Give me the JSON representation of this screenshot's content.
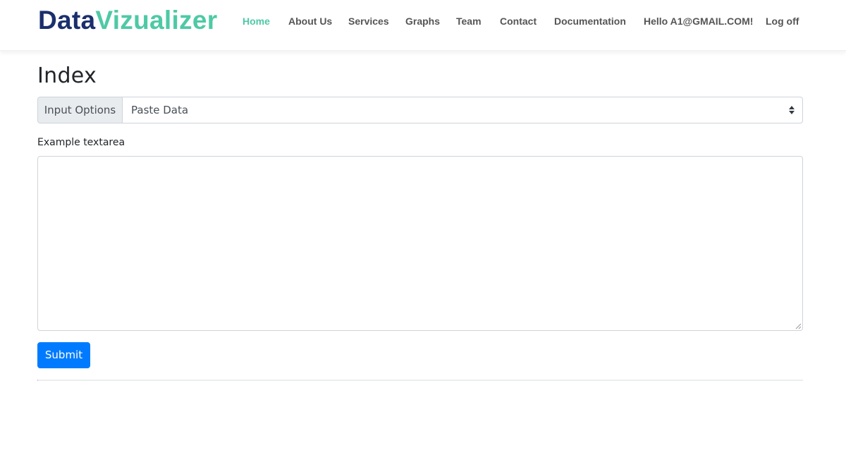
{
  "brand": {
    "part1": "Data",
    "part2": "Vizualizer",
    "color_part1": "#1b2f6e",
    "color_part2": "#4ec9a5"
  },
  "nav": {
    "items": [
      {
        "label": "Home",
        "active": true
      },
      {
        "label": "About Us",
        "active": false
      },
      {
        "label": "Services",
        "active": false
      },
      {
        "label": "Graphs",
        "active": false
      },
      {
        "label": "Team",
        "active": false
      },
      {
        "label": "Contact",
        "active": false
      },
      {
        "label": "Documentation",
        "active": false
      },
      {
        "label": "Hello A1@GMAIL.COM!",
        "active": false
      },
      {
        "label": "Log off",
        "active": false
      }
    ]
  },
  "main": {
    "title": "Index",
    "input_options": {
      "prepend_label": "Input Options",
      "selected": "Paste Data",
      "caret_icon": "sort-caret-icon"
    },
    "textarea": {
      "label": "Example textarea",
      "value": ""
    },
    "submit_label": "Submit",
    "accent_color": "#007bff"
  }
}
